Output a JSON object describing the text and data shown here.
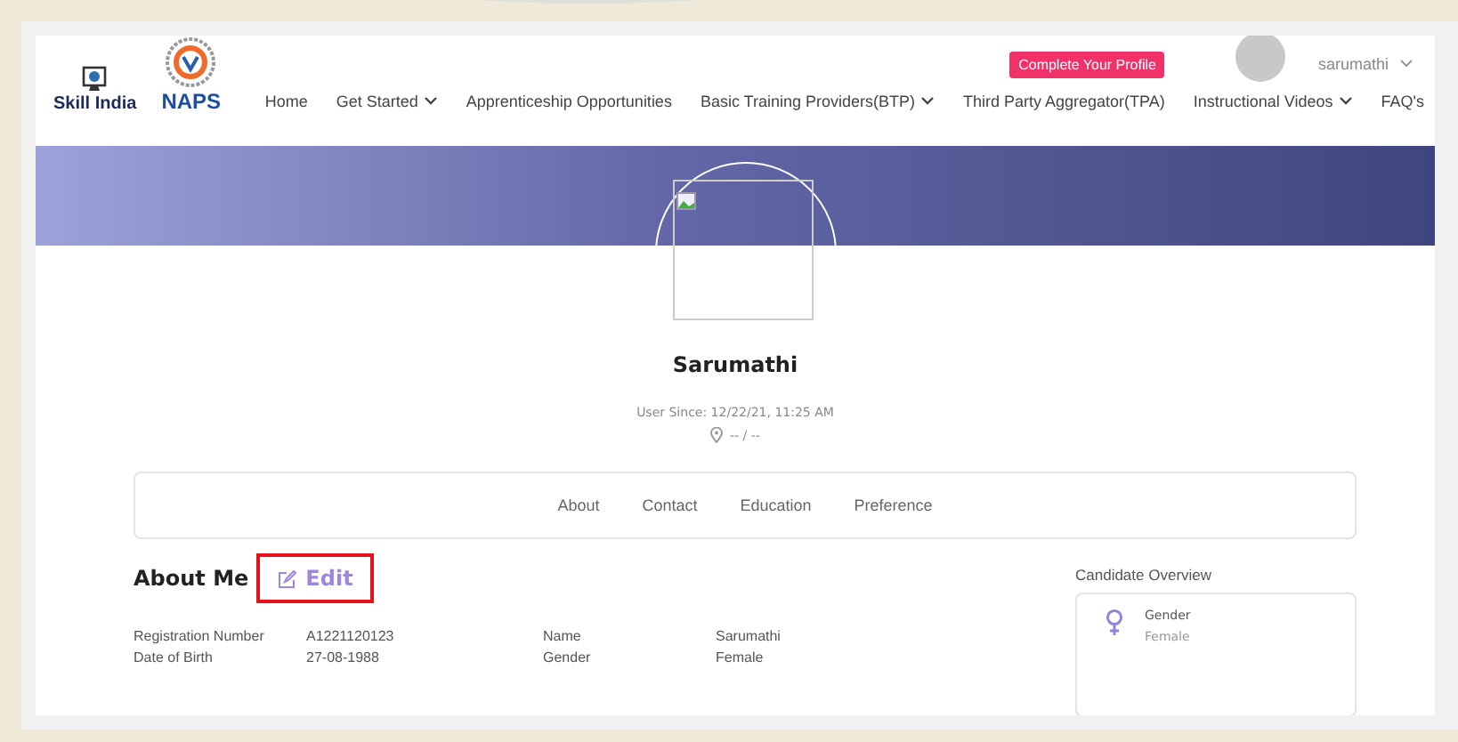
{
  "header": {
    "logos": [
      {
        "kind": "skill",
        "text": "Skill India"
      },
      {
        "kind": "naps",
        "text": "NAPS"
      }
    ],
    "nav": [
      {
        "label": "Home",
        "dropdown": false
      },
      {
        "label": "Get Started",
        "dropdown": true
      },
      {
        "label": "Apprenticeship Opportunities",
        "dropdown": false
      },
      {
        "label": "Basic Training Providers(BTP)",
        "dropdown": true
      },
      {
        "label": "Third Party Aggregator(TPA)",
        "dropdown": false
      },
      {
        "label": "Instructional Videos",
        "dropdown": true
      },
      {
        "label": "FAQ's",
        "dropdown": false
      }
    ],
    "cta": "Complete Your Profile",
    "user": "sarumathi"
  },
  "profile": {
    "name": "Sarumathi",
    "user_since": "User Since: 12/22/21, 11:25 AM",
    "location": "-- / --"
  },
  "tabs": [
    "About",
    "Contact",
    "Education",
    "Preference"
  ],
  "about": {
    "title": "About Me",
    "edit": "Edit",
    "highlighted": true,
    "rows": [
      [
        "Registration Number",
        "A1221120123",
        "Name",
        "Sarumathi"
      ],
      [
        "Date of Birth",
        "27-08-1988",
        "Gender",
        "Female"
      ]
    ]
  },
  "overview": {
    "title": "Candidate Overview",
    "items": [
      {
        "label": "Gender",
        "value": "Female"
      }
    ]
  }
}
